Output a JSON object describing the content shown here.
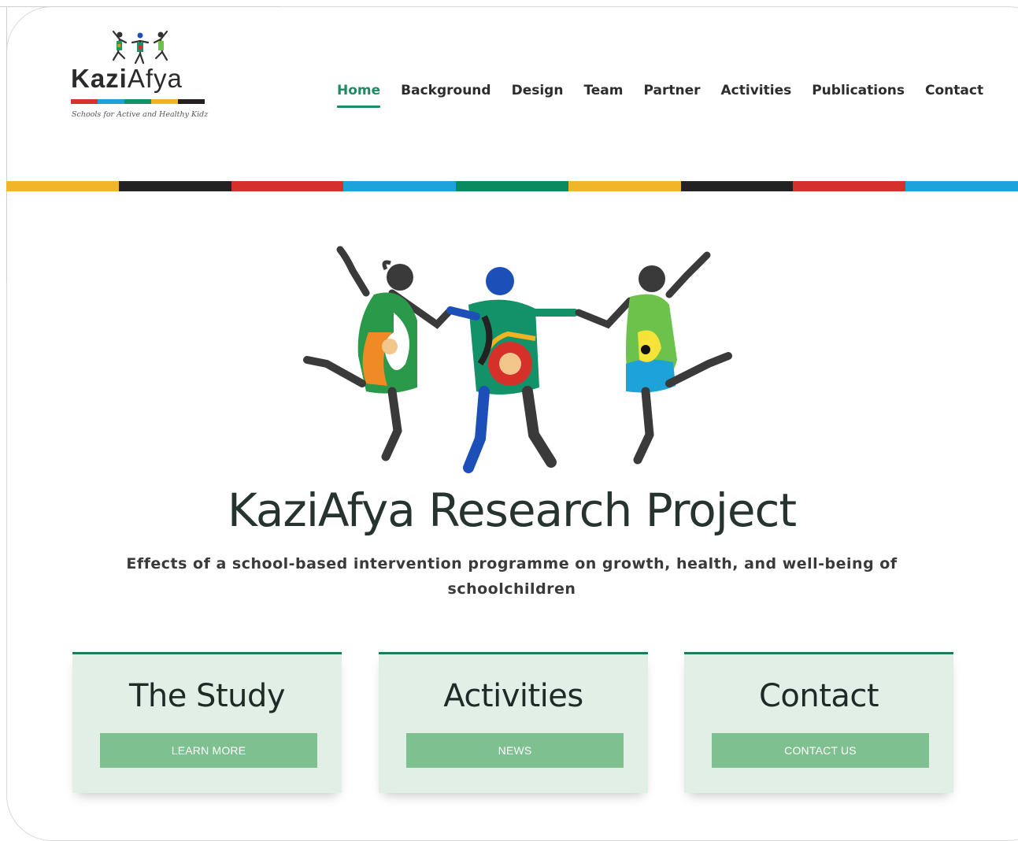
{
  "brand": {
    "name_bold": "Kazi",
    "name_light": "Afya",
    "tagline": "Schools for Active and Healthy Kidz",
    "stripe_colors": [
      "#d8302a",
      "#1da1d6",
      "#13926a",
      "#f0b323",
      "#231f20"
    ]
  },
  "nav": {
    "items": [
      {
        "label": "Home",
        "active": true
      },
      {
        "label": "Background",
        "active": false
      },
      {
        "label": "Design",
        "active": false
      },
      {
        "label": "Team",
        "active": false
      },
      {
        "label": "Partner",
        "active": false
      },
      {
        "label": "Activities",
        "active": false
      },
      {
        "label": "Publications",
        "active": false
      },
      {
        "label": "Contact",
        "active": false
      }
    ],
    "active_color": "#1f8a63"
  },
  "band_colors": [
    "#f1b52a",
    "#222222",
    "#d6302a",
    "#1ea3d8",
    "#0c8a5f",
    "#f1b52a",
    "#222222",
    "#d6302a",
    "#1ea3d8"
  ],
  "hero": {
    "title": "KaziAfya Research Project",
    "subtitle": "Effects of a school-based intervention programme on growth, health, and well-being of schoolchildren"
  },
  "cards": [
    {
      "title": "The Study",
      "button": "LEARN MORE"
    },
    {
      "title": "Activities",
      "button": "NEWS"
    },
    {
      "title": "Contact",
      "button": "CONTACT US"
    }
  ],
  "colors": {
    "card_bg": "#e1efe6",
    "card_border": "#1c7d5a",
    "button_bg": "#7ec08f"
  }
}
